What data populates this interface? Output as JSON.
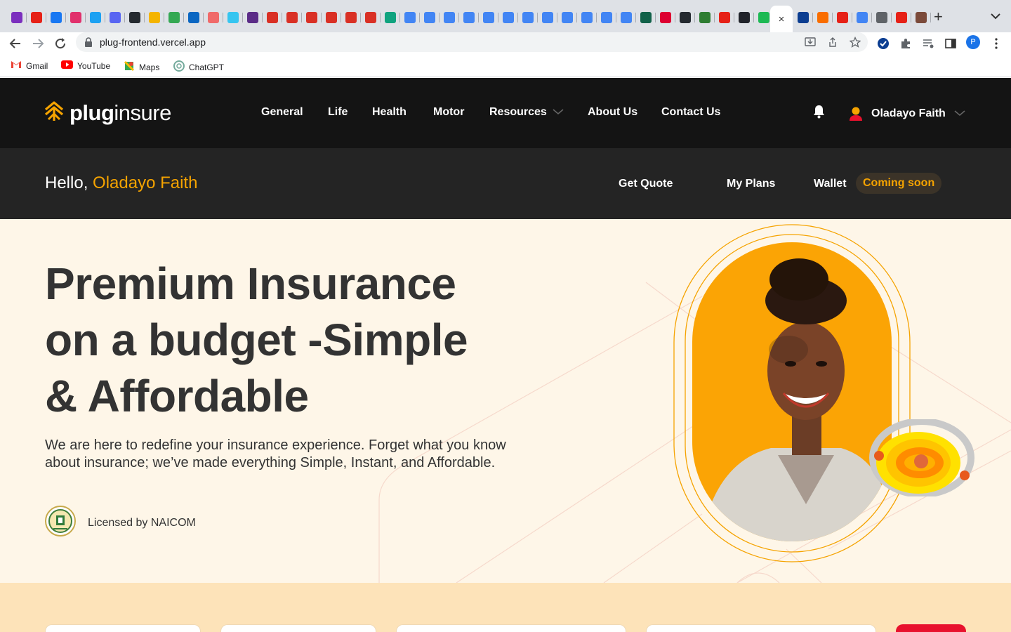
{
  "browser": {
    "tab_close_glyph": "×",
    "new_tab_glyph": "+",
    "url": "plug-frontend.vercel.app",
    "profile_initial": "P",
    "bookmarks": [
      {
        "label": "Gmail",
        "icon": "gmail-icon"
      },
      {
        "label": "YouTube",
        "icon": "youtube-icon"
      },
      {
        "label": "Maps",
        "icon": "maps-icon"
      },
      {
        "label": "ChatGPT",
        "icon": "chatgpt-icon"
      }
    ],
    "tab_favicon_colors": [
      "#7b2fbe",
      "#e62117",
      "#1877f2",
      "#e1306c",
      "#1da1f2",
      "#5865f2",
      "#24292f",
      "#f4b400",
      "#34a853",
      "#0a66c2",
      "#f06a6a",
      "#36c5f0",
      "#5b2c87",
      "#d93025",
      "#d93025",
      "#d93025",
      "#d93025",
      "#d93025",
      "#d93025",
      "#10a37f",
      "#4285f4",
      "#4285f4",
      "#4285f4",
      "#4285f4",
      "#4285f4",
      "#4285f4",
      "#4285f4",
      "#4285f4",
      "#4285f4",
      "#4285f4",
      "#4285f4",
      "#4285f4",
      "#116149",
      "#dd0031",
      "#24292f",
      "#2e7d32",
      "#e62117",
      "#20232a",
      "#1db954"
    ],
    "tab_favicon_colors_right": [
      "#0b3d91",
      "#f96d00",
      "#e62117",
      "#4285f4",
      "#5f6368",
      "#e62117",
      "#7b4a3a"
    ]
  },
  "site": {
    "brand_bold": "plug",
    "brand_light": "insure",
    "nav": [
      {
        "label": "General"
      },
      {
        "label": "Life"
      },
      {
        "label": "Health"
      },
      {
        "label": "Motor"
      },
      {
        "label": "Resources",
        "dropdown": true
      },
      {
        "label": "About Us"
      },
      {
        "label": "Contact Us"
      }
    ],
    "user_name": "Oladayo Faith",
    "greeting": "Hello,",
    "greeting_name": "Oladayo Faith",
    "subnav": {
      "get_quote": "Get Quote",
      "my_plans": "My Plans",
      "wallet": "Wallet",
      "wallet_badge": "Coming soon"
    },
    "hero": {
      "headline_line1": "Premium Insurance",
      "headline_line2": "on a budget -Simple",
      "headline_line3": "& Affordable",
      "paragraph": "We are here to redefine your insurance experience. Forget what you know about insurance; we’ve made everything Simple, Instant, and Affordable.",
      "license_text": "Licensed by NAICOM"
    },
    "colors": {
      "accent": "#f5a300",
      "header_bg": "#141414",
      "subheader_bg": "#242424",
      "hero_bg": "#fef6e8",
      "band_bg": "#fde3b9",
      "cta_red": "#e8112d"
    }
  }
}
